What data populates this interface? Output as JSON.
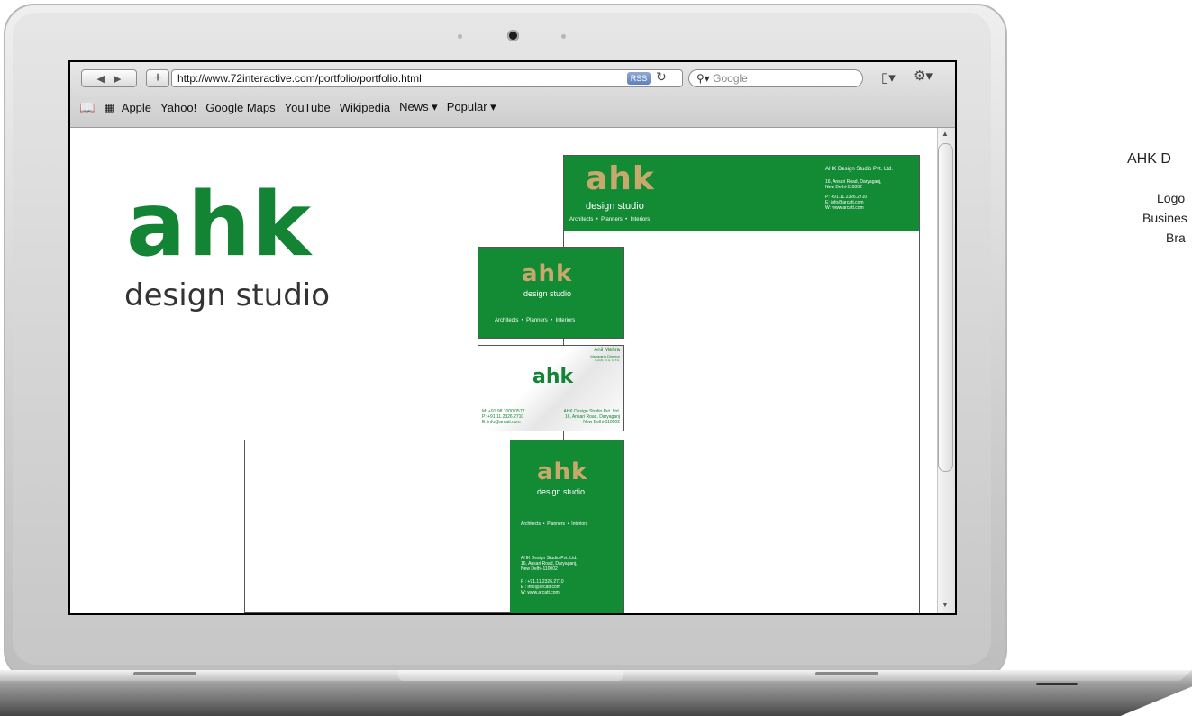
{
  "browser": {
    "url": "http://www.72interactive.com/portfolio/portfolio.html",
    "rss_label": "RSS",
    "search_placeholder": "Google",
    "bookmarks": [
      "Apple",
      "Yahoo!",
      "Google Maps",
      "YouTube",
      "Wikipedia",
      "News ▾",
      "Popular ▾"
    ]
  },
  "page": {
    "logo_wordmark": "ahk",
    "logo_tagline": "design studio",
    "letterhead": {
      "company": "AHK Design Studio Pvt. Ltd.",
      "address1": "16, Ansari Road, Daryaganj,",
      "address2": "New Delhi-110002",
      "phone": "P: +91.11.2326.2710",
      "email": "E: info@arcatt.com",
      "web": "W: www.arcatt.com",
      "services": "Architects  •  Planners  •  Interiors"
    },
    "card_front": {
      "services": "Architects  •  Planners  •  Interiors"
    },
    "card_back": {
      "name": "Anil Mehra",
      "title": "Managing Director",
      "degree": "B.Arch, F.I.A., M.T.A.",
      "mobile": "M: +91.98.1000.0577",
      "phone": "P: +91.11.2326.2710",
      "email": "E: info@arcatt.com",
      "company": "AHK Design Studio Pvt. Ltd.",
      "address1": "16, Ansari Road, Daryaganj",
      "address2": "New Delhi-110002"
    },
    "envelope": {
      "services": "Architects  •  Planners  •  Interiors",
      "company": "AHK Design Studio Pvt. Ltd.",
      "address1": "16, Ansari Road, Daryaganj,",
      "address2": "New Delhi-110002",
      "phone": "P : +91.11.2326.2710",
      "email": "E : info@arcatt.com",
      "web": "W: www.arcatt.com"
    }
  },
  "side_panel": {
    "title": "AHK D",
    "items": [
      "Logo",
      "Busines",
      "Bra"
    ]
  },
  "colors": {
    "brand_green": "#138a34",
    "brand_gold": "#c7a96b"
  }
}
